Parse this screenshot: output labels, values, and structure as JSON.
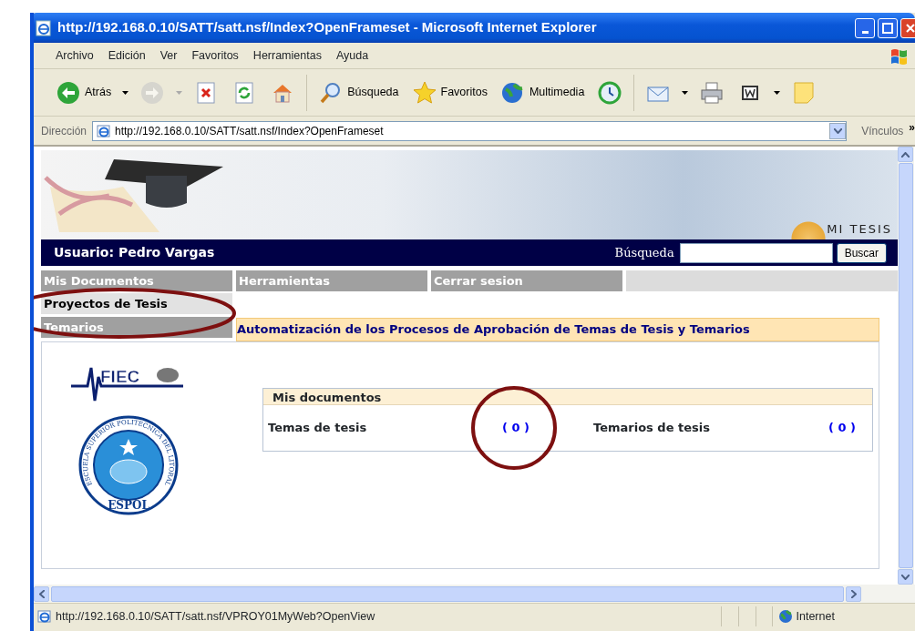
{
  "window": {
    "title": "http://192.168.0.10/SATT/satt.nsf/Index?OpenFrameset - Microsoft Internet Explorer"
  },
  "menu_bar": [
    "Archivo",
    "Edición",
    "Ver",
    "Favoritos",
    "Herramientas",
    "Ayuda"
  ],
  "toolbar": [
    {
      "kind": "back",
      "label": "Atrás",
      "menu": true,
      "disabled": false
    },
    {
      "kind": "forward",
      "menu": true,
      "disabled": true
    },
    {
      "kind": "stop",
      "menu": false,
      "disabled": false
    },
    {
      "kind": "refresh",
      "menu": false,
      "disabled": false
    },
    {
      "kind": "home",
      "menu": false,
      "disabled": false
    },
    {
      "kind": "search",
      "label": "Búsqueda",
      "menu": false,
      "disabled": false
    },
    {
      "kind": "favorites",
      "label": "Favoritos",
      "menu": false,
      "disabled": false
    },
    {
      "kind": "media",
      "label": "Multimedia",
      "menu": false,
      "disabled": false
    },
    {
      "kind": "history",
      "menu": false,
      "disabled": false
    },
    {
      "kind": "mail",
      "menu": true,
      "disabled": false
    },
    {
      "kind": "print",
      "menu": false,
      "disabled": false
    },
    {
      "kind": "word",
      "menu": true,
      "disabled": false
    },
    {
      "kind": "note",
      "menu": false,
      "disabled": false
    }
  ],
  "address_bar": {
    "label": "Dirección",
    "value": "http://192.168.0.10/SATT/satt.nsf/Index?OpenFrameset",
    "links_label": "Vínculos",
    "more": "»"
  },
  "page": {
    "banner": {
      "logo_text": "MI TESIS"
    },
    "header": {
      "user": "Usuario: Pedro Vargas",
      "search_label": "Búsqueda",
      "search_button": "Buscar"
    },
    "nav": [
      {
        "label": "Mis Documentos",
        "children": [
          {
            "label": "Proyectos de Tesis",
            "selected": true,
            "circled": true
          },
          {
            "label": "Temarios",
            "selected": false,
            "circled": false
          }
        ]
      },
      {
        "label": "Herramientas"
      },
      {
        "label": "Cerrar sesion"
      }
    ],
    "title": "Automatización de los Procesos de Aprobación de Temas de Tesis y Temarios",
    "logos": [
      {
        "kind": "fiec",
        "text": "FIEC"
      },
      {
        "kind": "seal",
        "text": "ESPOL",
        "ring_text": "ESCUELA SUPERIOR POLITECNICA DEL LITORAL"
      }
    ],
    "documents": {
      "title": "Mis documentos",
      "items": [
        {
          "label": "Temas de tesis",
          "count": "( 0 )",
          "circled": true
        },
        {
          "label": "Temarios de tesis",
          "count": "( 0 )",
          "circled": false
        }
      ]
    }
  },
  "status_bar": {
    "url": "http://192.168.0.10/SATT/satt.nsf/VPROY01MyWeb?OpenView",
    "zone": "Internet"
  }
}
